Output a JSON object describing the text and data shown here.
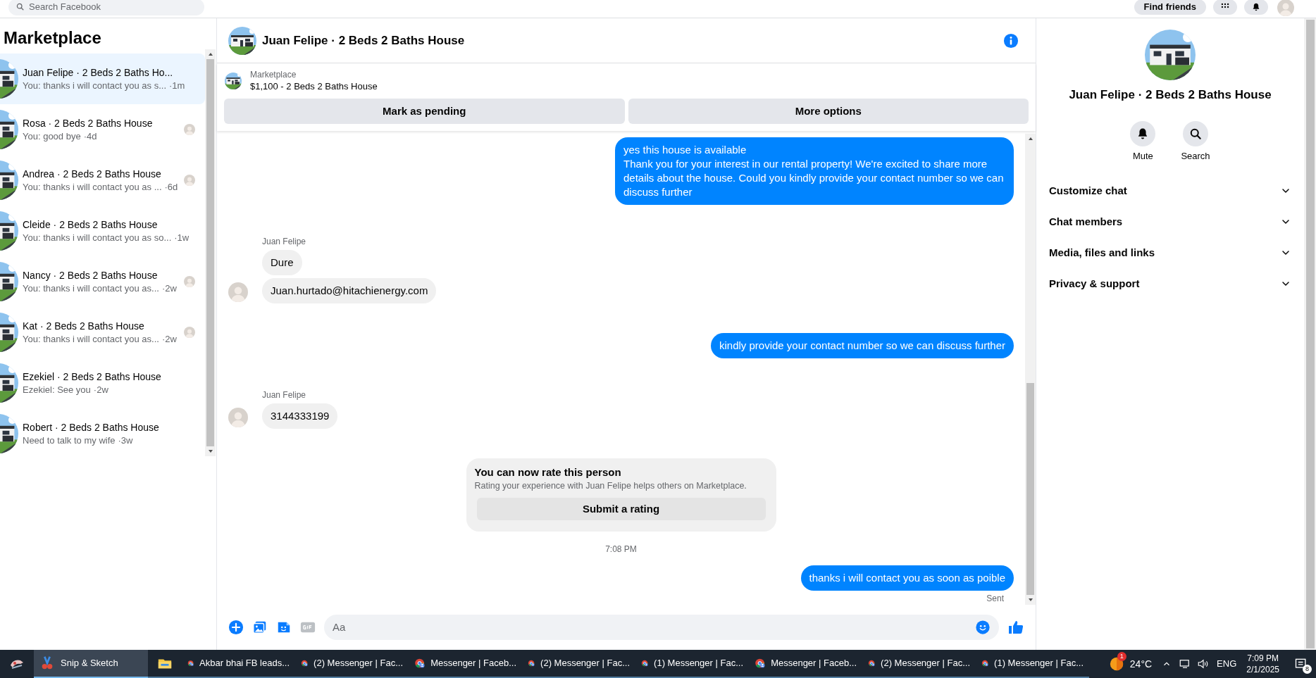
{
  "top_bar": {
    "search_placeholder": "Search Facebook",
    "find_friends": "Find friends"
  },
  "sidebar": {
    "title": "Marketplace",
    "conversations": [
      {
        "title": "Juan Felipe · 2 Beds 2 Baths Ho...",
        "preview": "You: thanks i will contact you as s...",
        "time": "·1m",
        "selected": true,
        "seen_avatar": false
      },
      {
        "title": "Rosa · 2 Beds 2 Baths House",
        "preview": "You: good bye",
        "time": "·4d",
        "selected": false,
        "seen_avatar": true
      },
      {
        "title": "Andrea · 2 Beds 2 Baths House",
        "preview": "You: thanks i will contact you as ...",
        "time": "·6d",
        "selected": false,
        "seen_avatar": true
      },
      {
        "title": "Cleide · 2 Beds 2 Baths House",
        "preview": "You: thanks i will contact you as so...",
        "time": "·1w",
        "selected": false,
        "seen_avatar": false
      },
      {
        "title": "Nancy · 2 Beds 2 Baths House",
        "preview": "You: thanks i will contact you as...",
        "time": "·2w",
        "selected": false,
        "seen_avatar": true
      },
      {
        "title": "Kat · 2 Beds 2 Baths House",
        "preview": "You: thanks i will contact you as...",
        "time": "·2w",
        "selected": false,
        "seen_avatar": true
      },
      {
        "title": "Ezekiel · 2 Beds 2 Baths House",
        "preview": "Ezekiel: See you",
        "time": "·2w",
        "selected": false,
        "seen_avatar": false
      },
      {
        "title": "Robert · 2 Beds 2 Baths House",
        "preview": "Need to talk to my wife",
        "time": "·3w",
        "selected": false,
        "seen_avatar": false
      }
    ]
  },
  "chat": {
    "title": "Juan Felipe · 2 Beds 2 Baths House",
    "listing": {
      "label": "Marketplace",
      "title": "$1,100 - 2 Beds 2 Baths House"
    },
    "actions": [
      "Mark as pending",
      "More options"
    ],
    "messages": [
      {
        "kind": "sent",
        "text": "yes this house is available\nThank you for your interest in our rental property! We're excited to share more details about the house. Could you kindly provide your contact number so we can discuss further"
      },
      {
        "kind": "sender_name",
        "text": "Juan Felipe"
      },
      {
        "kind": "received",
        "text": "Dure",
        "avatar": false
      },
      {
        "kind": "received",
        "text": "Juan.hurtado@hitachienergy.com",
        "avatar": true
      },
      {
        "kind": "sent",
        "text": "kindly provide your contact number so we can discuss further"
      },
      {
        "kind": "sender_name",
        "text": "Juan Felipe"
      },
      {
        "kind": "received",
        "text": "3144333199",
        "avatar": true
      },
      {
        "kind": "rating_card",
        "title": "You can now rate this person",
        "body": "Rating your experience with Juan Felipe helps others on Marketplace.",
        "button": "Submit a rating"
      },
      {
        "kind": "timestamp",
        "text": "7:08 PM"
      },
      {
        "kind": "sent",
        "text": "thanks i will contact you as soon as poible"
      },
      {
        "kind": "status",
        "text": "Sent"
      }
    ],
    "composer": {
      "placeholder": "Aa"
    }
  },
  "details": {
    "title": "Juan Felipe · 2 Beds 2 Baths House",
    "actions": [
      {
        "kind": "mute",
        "label": "Mute"
      },
      {
        "kind": "search",
        "label": "Search"
      }
    ],
    "sections": [
      {
        "label": "Customize chat",
        "expanded": false
      },
      {
        "label": "Chat members",
        "expanded": false
      },
      {
        "label": "Media, files and links",
        "expanded": false
      },
      {
        "label": "Privacy & support",
        "expanded": false
      }
    ]
  },
  "taskbar": {
    "apps": [
      {
        "kind": "snip",
        "label": "Snip & Sketch",
        "selected": true
      },
      {
        "kind": "explorer",
        "selected": false
      },
      {
        "kind": "browser",
        "label": "Akbar bhai FB leads...",
        "selected": false
      },
      {
        "kind": "browser",
        "label": "(2) Messenger | Fac...",
        "selected": false
      },
      {
        "kind": "browser",
        "label": "Messenger | Faceb...",
        "selected": false
      },
      {
        "kind": "browser",
        "label": "(2) Messenger | Fac...",
        "selected": false
      },
      {
        "kind": "browser",
        "label": "(1) Messenger | Fac...",
        "selected": false
      },
      {
        "kind": "browser",
        "label": "Messenger | Faceb...",
        "selected": false
      },
      {
        "kind": "browser",
        "label": "(2) Messenger | Fac...",
        "selected": false
      },
      {
        "kind": "browser",
        "label": "(1) Messenger | Fac...",
        "selected": false
      }
    ],
    "weather": {
      "badge": "1",
      "temp": "24°C"
    },
    "language": "ENG",
    "time": "7:09 PM",
    "date": "2/1/2025",
    "notifications": "8"
  }
}
